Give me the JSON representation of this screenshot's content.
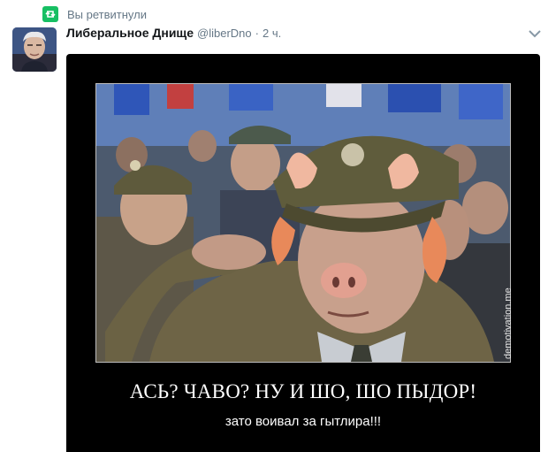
{
  "retweet": {
    "label": "Вы ретвитнули",
    "icon": "retweet-icon"
  },
  "author": {
    "name": "Либеральное Днище",
    "handle": "@liberDno",
    "separator": "·",
    "time": "2 ч."
  },
  "menu": {
    "icon": "chevron-down-icon"
  },
  "media": {
    "watermark": "demotivation.me",
    "title": "АСЬ? ЧАВО? НУ И ШО, ШО ПЫДОР!",
    "subtitle": "зато воивал за гытлира!!!"
  },
  "colors": {
    "accent": "#17bf63",
    "muted": "#657786",
    "text": "#14171a"
  }
}
